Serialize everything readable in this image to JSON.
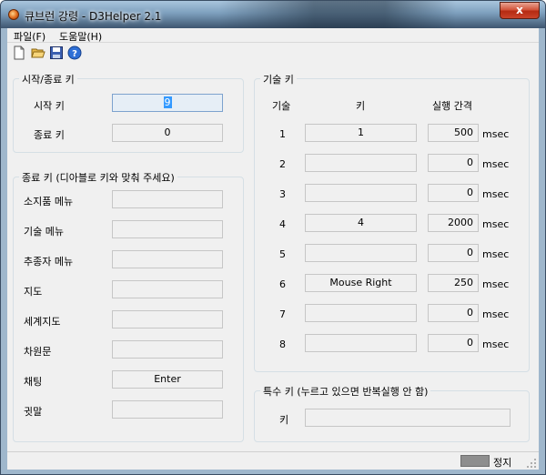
{
  "window": {
    "title": "큐브런 강령 - D3Helper 2.1",
    "close_glyph": "x"
  },
  "menu": [
    {
      "label": "파일(F)"
    },
    {
      "label": "도움말(H)"
    }
  ],
  "toolbar": [
    "new-file-icon",
    "open-folder-icon",
    "save-icon",
    "help-icon"
  ],
  "startstop": {
    "title": "시작/종료 키",
    "start_label": "시작 키",
    "start_value": "9",
    "stop_label": "종료 키",
    "stop_value": "0"
  },
  "cancel": {
    "title": "종료 키 (디아블로 키와 맞춰 주세요)",
    "rows": [
      {
        "label": "소지품 메뉴",
        "value": ""
      },
      {
        "label": "기술 메뉴",
        "value": ""
      },
      {
        "label": "추종자 메뉴",
        "value": ""
      },
      {
        "label": "지도",
        "value": ""
      },
      {
        "label": "세계지도",
        "value": ""
      },
      {
        "label": "차원문",
        "value": ""
      },
      {
        "label": "채팅",
        "value": "Enter"
      },
      {
        "label": "귓말",
        "value": ""
      }
    ]
  },
  "skills": {
    "title": "기술 키",
    "col_skill": "기술",
    "col_key": "키",
    "col_interval": "실행 간격",
    "unit": "msec",
    "rows": [
      {
        "num": "1",
        "key": "1",
        "interval": "500"
      },
      {
        "num": "2",
        "key": "",
        "interval": "0"
      },
      {
        "num": "3",
        "key": "",
        "interval": "0"
      },
      {
        "num": "4",
        "key": "4",
        "interval": "2000"
      },
      {
        "num": "5",
        "key": "",
        "interval": "0"
      },
      {
        "num": "6",
        "key": "Mouse Right",
        "interval": "250"
      },
      {
        "num": "7",
        "key": "",
        "interval": "0"
      },
      {
        "num": "8",
        "key": "",
        "interval": "0"
      }
    ]
  },
  "special": {
    "title": "특수 키 (누르고 있으면 반복실행 안 함)",
    "key_label": "키",
    "key_value": ""
  },
  "status": {
    "text": "정지"
  }
}
